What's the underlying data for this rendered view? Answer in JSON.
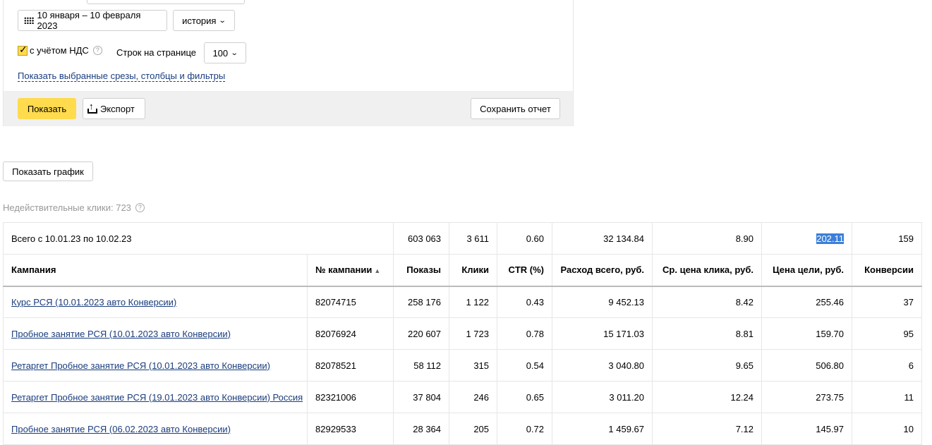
{
  "filters": {
    "date_range": "10 января – 10 февраля 2023",
    "history_label": "история",
    "vat_label": "с учётом НДС",
    "vat_checked": true,
    "help_glyph": "?",
    "rows_label": "Строк на странице",
    "rows_value": "100",
    "show_selected_link": "Показать выбранные срезы, столбцы и фильтры"
  },
  "actions": {
    "show_label": "Показать",
    "export_label": "Экспорт",
    "save_label": "Сохранить отчет",
    "show_graph_label": "Показать график"
  },
  "invalid_clicks": "Недействительные клики: 723",
  "summary": {
    "label": "Всего с 10.01.23 по 10.02.23",
    "impressions": "603 063",
    "clicks": "3 611",
    "ctr": "0.60",
    "spend": "32 134.84",
    "cpc": "8.90",
    "cpa": "202.11",
    "conversions": "159"
  },
  "columns": {
    "campaign": "Кампания",
    "campaign_id": "№ кампании",
    "sort_indicator": "▲",
    "impressions": "Показы",
    "clicks": "Клики",
    "ctr": "CTR (%)",
    "spend": "Расход всего, руб.",
    "cpc": "Ср. цена клика, руб.",
    "cpa": "Цена цели, руб.",
    "conversions": "Конверсии"
  },
  "rows": [
    {
      "name": "Курс РСЯ (10.01.2023 авто Конверсии)",
      "id": "82074715",
      "impressions": "258 176",
      "clicks": "1 122",
      "ctr": "0.43",
      "spend": "9 452.13",
      "cpc": "8.42",
      "cpa": "255.46",
      "conversions": "37"
    },
    {
      "name": "Пробное занятие РСЯ (10.01.2023 авто Конверсии)",
      "id": "82076924",
      "impressions": "220 607",
      "clicks": "1 723",
      "ctr": "0.78",
      "spend": "15 171.03",
      "cpc": "8.81",
      "cpa": "159.70",
      "conversions": "95"
    },
    {
      "name": "Ретаргет Пробное занятие РСЯ (10.01.2023 авто Конверсии)",
      "id": "82078521",
      "impressions": "58 112",
      "clicks": "315",
      "ctr": "0.54",
      "spend": "3 040.80",
      "cpc": "9.65",
      "cpa": "506.80",
      "conversions": "6"
    },
    {
      "name": "Ретаргет Пробное занятие РСЯ (19.01.2023 авто Конверсии) Россия",
      "id": "82321006",
      "impressions": "37 804",
      "clicks": "246",
      "ctr": "0.65",
      "spend": "3 011.20",
      "cpc": "12.24",
      "cpa": "273.75",
      "conversions": "11"
    },
    {
      "name": "Пробное занятие РСЯ (06.02.2023 авто Конверсии)",
      "id": "82929533",
      "impressions": "28 364",
      "clicks": "205",
      "ctr": "0.72",
      "spend": "1 459.67",
      "cpc": "7.12",
      "cpa": "145.97",
      "conversions": "10"
    }
  ]
}
